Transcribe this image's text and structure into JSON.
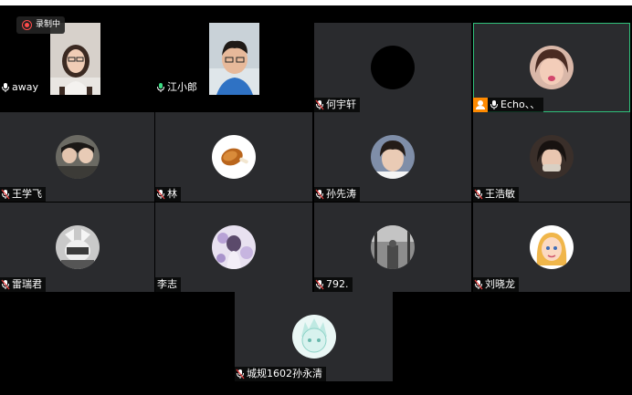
{
  "recording": {
    "label": "录制中"
  },
  "participants": [
    {
      "name": "away",
      "mic": "on"
    },
    {
      "name": "江小郎",
      "mic": "on"
    },
    {
      "name": "何宇轩",
      "mic": "muted"
    },
    {
      "name": "Echo、、",
      "mic": "on",
      "host": true
    },
    {
      "name": "王学飞",
      "mic": "muted"
    },
    {
      "name": "林",
      "mic": "muted"
    },
    {
      "name": "孙先涛",
      "mic": "muted"
    },
    {
      "name": "王浩敏",
      "mic": "muted"
    },
    {
      "name": "雷瑞君",
      "mic": "muted"
    },
    {
      "name": "李志",
      "mic": "none"
    },
    {
      "name": "792.",
      "mic": "muted"
    },
    {
      "name": "刘晓龙",
      "mic": "muted"
    },
    {
      "name": "城规1602孙永清",
      "mic": "muted"
    }
  ],
  "colors": {
    "tile_bg": "#2a2b2e",
    "active_border": "#2fbf7a",
    "host_badge": "#ff8a00",
    "recording": "#ff4b4b"
  }
}
